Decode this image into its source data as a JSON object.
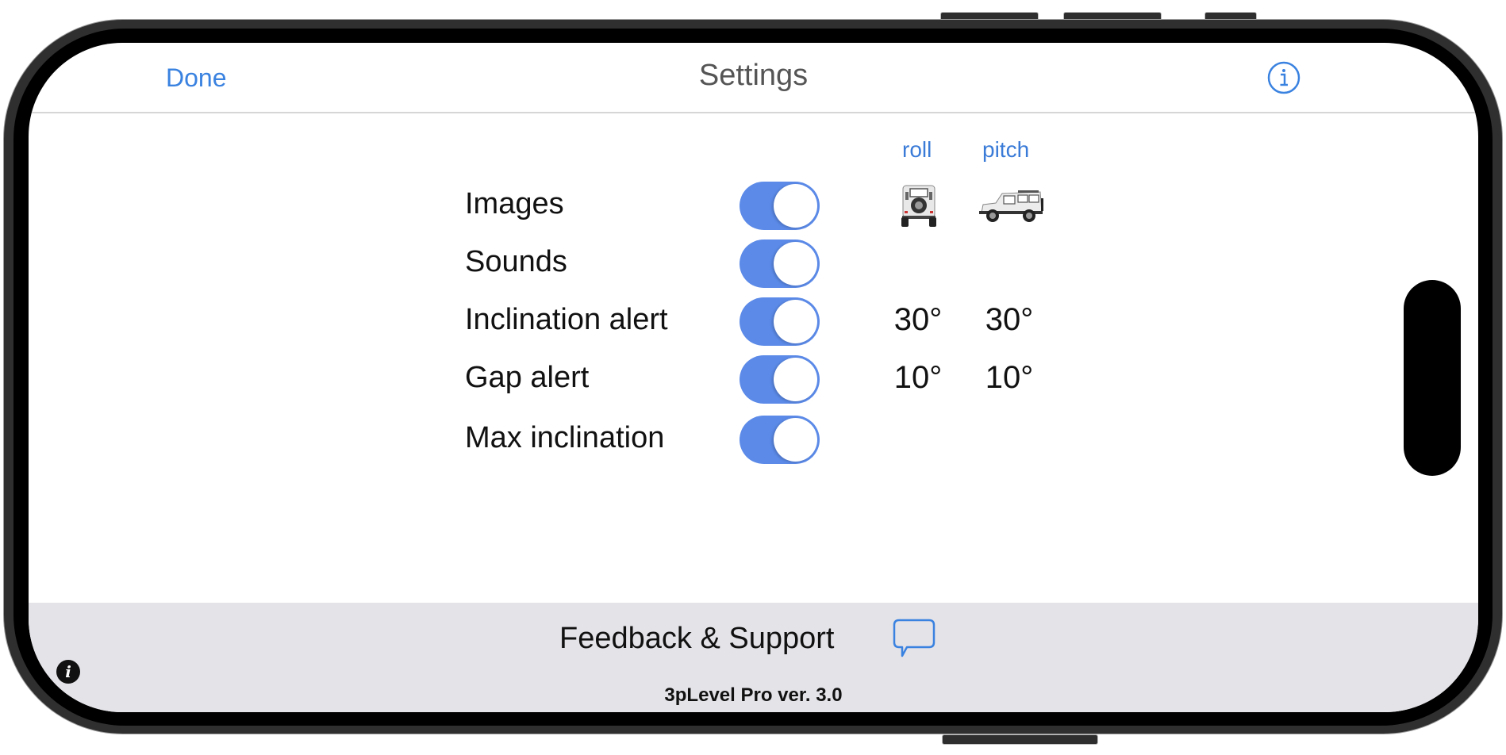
{
  "navbar": {
    "done_label": "Done",
    "title": "Settings",
    "info_icon": "info-circle-icon"
  },
  "columns": {
    "roll": "roll",
    "pitch": "pitch"
  },
  "car_images": {
    "roll": "car-rear-view-icon",
    "pitch": "car-side-view-icon"
  },
  "settings": [
    {
      "label": "Images",
      "on": true,
      "roll": "",
      "pitch": ""
    },
    {
      "label": "Sounds",
      "on": true,
      "roll": "",
      "pitch": ""
    },
    {
      "label": "Inclination alert",
      "on": true,
      "roll": "30°",
      "pitch": "30°"
    },
    {
      "label": "Gap alert",
      "on": true,
      "roll": "10°",
      "pitch": "10°"
    },
    {
      "label": "Max inclination",
      "on": true,
      "roll": "",
      "pitch": ""
    }
  ],
  "footer": {
    "feedback_label": "Feedback & Support",
    "chat_icon": "chat-bubble-icon",
    "version": "3pLevel Pro ver. 3.0",
    "info_icon": "info-icon"
  },
  "colors": {
    "accent": "#3a82e0",
    "toggle_on": "#5b8ae8",
    "footer_bg": "#e4e3e8"
  }
}
